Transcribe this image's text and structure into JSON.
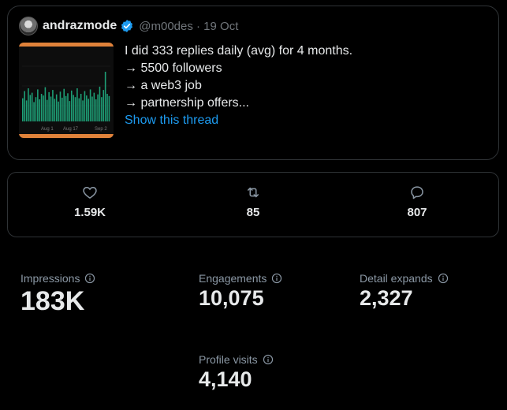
{
  "tweet": {
    "username": "andrazmode",
    "handle_date": "@m00des · 19 Oct",
    "text_lines": [
      "I did 333 replies daily (avg) for 4 months.",
      "",
      "→ 5500 followers",
      "→ a web3 job",
      "→ partnership offers..."
    ],
    "show_thread": "Show this thread",
    "thumbnail": {
      "x_labels": [
        "Aug 1",
        "Aug 17",
        "Sep 2"
      ],
      "bars": [
        0.42,
        0.55,
        0.38,
        0.6,
        0.48,
        0.52,
        0.35,
        0.44,
        0.58,
        0.4,
        0.5,
        0.47,
        0.62,
        0.39,
        0.53,
        0.45,
        0.57,
        0.41,
        0.49,
        0.36,
        0.54,
        0.43,
        0.59,
        0.46,
        0.51,
        0.37,
        0.56,
        0.48,
        0.44,
        0.6,
        0.42,
        0.5,
        0.38,
        0.55,
        0.47,
        0.41,
        0.58,
        0.45,
        0.52,
        0.4,
        0.49,
        0.63,
        0.44,
        0.57,
        0.9,
        0.5,
        0.46
      ],
      "bar_color": "#1e9f76",
      "accent_color": "#e0823a"
    }
  },
  "engagement": {
    "likes": "1.59K",
    "retweets": "85",
    "replies": "807"
  },
  "metrics": {
    "impressions_label": "Impressions",
    "impressions_value": "183K",
    "engagements_label": "Engagements",
    "engagements_value": "10,075",
    "detail_expands_label": "Detail expands",
    "detail_expands_value": "2,327",
    "profile_visits_label": "Profile visits",
    "profile_visits_value": "4,140"
  },
  "colors": {
    "background": "#000000",
    "border": "#2f3336",
    "link": "#1d9bf0",
    "muted": "#71767b",
    "verified": "#1d9bf0"
  }
}
